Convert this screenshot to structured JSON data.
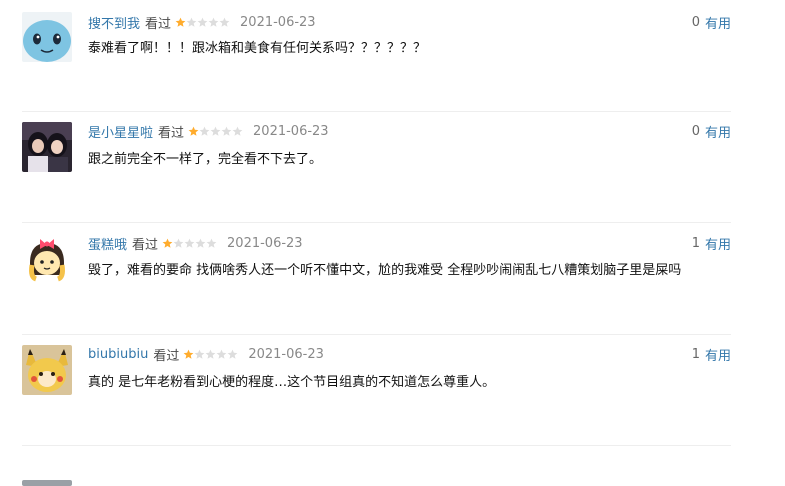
{
  "comments": [
    {
      "user": "搜不到我",
      "status": "看过",
      "rating": 1,
      "date": "2021-06-23",
      "useful_count": "0",
      "useful_label": "有用",
      "text": "泰难看了啊！！！跟冰箱和美食有任何关系吗？？？？？？",
      "avatar": "squirtle-avatar"
    },
    {
      "user": "是小星星啦",
      "status": "看过",
      "rating": 1,
      "date": "2021-06-23",
      "useful_count": "0",
      "useful_label": "有用",
      "text": "跟之前完全不一样了，完全看不下去了。",
      "avatar": "girls-photo-avatar"
    },
    {
      "user": "蛋糕哦",
      "status": "看过",
      "rating": 1,
      "date": "2021-06-23",
      "useful_count": "1",
      "useful_label": "有用",
      "text": "毁了，难看的要命 找俩啥秀人还一个听不懂中文，尬的我难受 全程吵吵闹闹乱七八糟策划脑子里是屎吗",
      "avatar": "cartoon-girl-avatar"
    },
    {
      "user": "biubiubiu",
      "status": "看过",
      "rating": 1,
      "date": "2021-06-23",
      "useful_count": "1",
      "useful_label": "有用",
      "text": "真的 是七年老粉看到心梗的程度…这个节目组真的不知道怎么尊重人。",
      "avatar": "pikachu-avatar"
    }
  ],
  "colors": {
    "star_on": "#ffac2d",
    "star_off": "#dddddd",
    "link": "#3377aa"
  }
}
